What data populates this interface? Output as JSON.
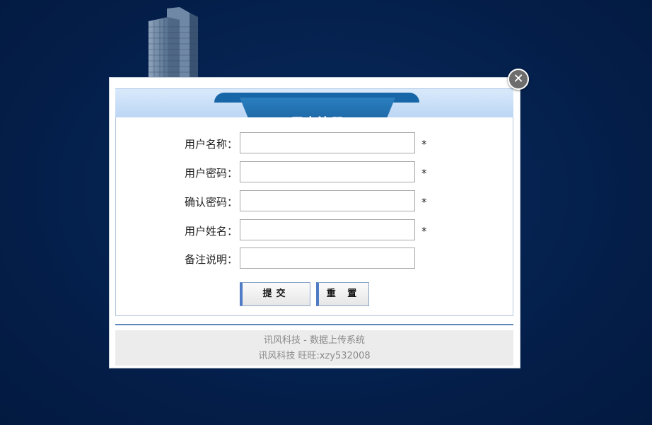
{
  "dialog": {
    "title": "用户注册",
    "close_symbol": "✕"
  },
  "form": {
    "fields": [
      {
        "label": "用户名称：",
        "value": "",
        "required_mark": "*"
      },
      {
        "label": "用户密码：",
        "value": "",
        "required_mark": "*"
      },
      {
        "label": "确认密码：",
        "value": "",
        "required_mark": "*"
      },
      {
        "label": "用户姓名：",
        "value": "",
        "required_mark": "*"
      },
      {
        "label": "备注说明：",
        "value": "",
        "required_mark": ""
      }
    ],
    "submit_label": "提交",
    "reset_label": "重 置"
  },
  "footer": {
    "line1": "讯风科技 - 数据上传系统",
    "line2": "讯风科技 旺旺:xzy532008"
  },
  "colors": {
    "background": "#041f4b",
    "title_tab": "#1766a7",
    "header_band": "#cfe2f8",
    "button_accent": "#4f7cc4"
  }
}
